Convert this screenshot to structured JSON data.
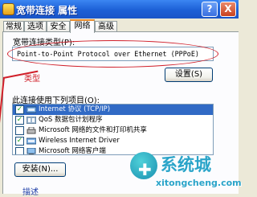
{
  "window": {
    "title": "宽带连接 属性",
    "help_label": "?",
    "close_label": "X"
  },
  "tabs": [
    {
      "label": "常规",
      "active": false
    },
    {
      "label": "选项",
      "active": false
    },
    {
      "label": "安全",
      "active": false
    },
    {
      "label": "网络",
      "active": true
    },
    {
      "label": "高级",
      "active": false
    }
  ],
  "network": {
    "connect_type_label": "宽带连接类型(P):",
    "device_value": "Point-to-Point Protocol over Ethernet (PPPoE)",
    "annotation": "类型",
    "configure_label": "设置(S)",
    "items_label": "此连接使用下列项目(O):",
    "install_label": "安装(N)...",
    "description_label": "描述"
  },
  "items": [
    {
      "label": "Internet 协议 (TCP/IP)",
      "checked": true,
      "selected": true,
      "icon": "protocol-icon"
    },
    {
      "label": "QoS 数据包计划程序",
      "checked": true,
      "selected": false,
      "icon": "service-icon"
    },
    {
      "label": "Microsoft 网络的文件和打印机共享",
      "checked": false,
      "selected": false,
      "icon": "printer-share-icon"
    },
    {
      "label": "Wireless Internet Driver",
      "checked": true,
      "selected": false,
      "icon": "protocol-icon"
    },
    {
      "label": "Microsoft 网络客户端",
      "checked": false,
      "selected": false,
      "icon": "client-icon"
    }
  ],
  "watermark": {
    "brand": "系统城",
    "url": "xitongcheng.com"
  },
  "colors": {
    "accent_blue": "#316ac5",
    "annotation_red": "#d1202a",
    "titlebar_blue": "#1c5fd6",
    "check_green": "#21a121"
  }
}
